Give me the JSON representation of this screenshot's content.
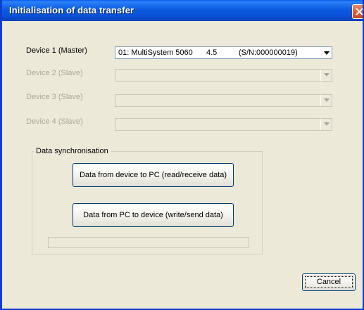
{
  "window": {
    "title": "Initialisation of data transfer"
  },
  "devices": [
    {
      "label": "Device 1 (Master)",
      "enabled": true,
      "selected": {
        "port": "01: MultiSystem 5060",
        "version": "4.5",
        "serial": "(S/N:000000019)"
      }
    },
    {
      "label": "Device 2 (Slave)",
      "enabled": false,
      "selected": ""
    },
    {
      "label": "Device 3 (Slave)",
      "enabled": false,
      "selected": ""
    },
    {
      "label": "Device 4 (Slave)",
      "enabled": false,
      "selected": ""
    }
  ],
  "sync": {
    "group_label": "Data synchronisation",
    "read_button": "Data from device to PC (read/receive data)",
    "write_button": "Data from PC to device (write/send data)",
    "progress": 0
  },
  "footer": {
    "cancel_button": "Cancel"
  },
  "icons": {
    "close": "close-icon",
    "dropdown": "chevron-down-icon"
  },
  "colors": {
    "titlebar": "#0a59ee",
    "dialog_bg": "#ece9d8",
    "close_button": "#e0603b",
    "disabled_text": "#aca899"
  }
}
